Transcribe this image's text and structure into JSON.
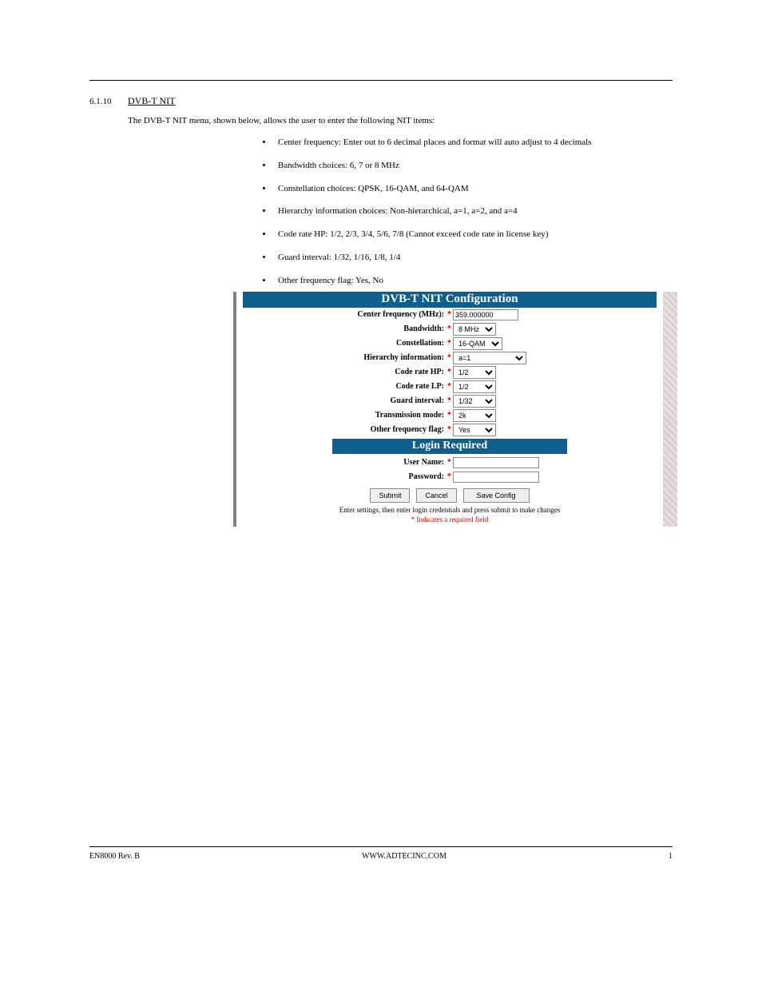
{
  "header": {
    "section_number": "6.1.10",
    "section_title": "DVB-T NIT"
  },
  "intro": "The DVB-T NIT menu, shown below, allows the user to enter the following NIT items:",
  "bullets": [
    "Center frequency: Enter out to 6 decimal places and format will auto adjust to 4 decimals",
    "Bandwidth choices: 6, 7 or 8 MHz",
    "Constellation choices: QPSK, 16-QAM, and 64-QAM",
    "Hierarchy information choices:  Non-hierarchical, a=1, a=2, and a=4",
    "Code rate HP: 1/2, 2/3, 3/4, 5/6, 7/8  (Cannot exceed code rate in license key)",
    "Guard interval: 1/32, 1/16, 1/8, 1/4",
    "Other frequency flag: Yes, No"
  ],
  "panel": {
    "title": "DVB-T NIT Configuration",
    "login_title": "Login Required",
    "fields": {
      "center_freq": {
        "label": "Center frequency (MHz):",
        "value": "359.000000"
      },
      "bandwidth": {
        "label": "Bandwidth:",
        "value": "8 MHz"
      },
      "constellation": {
        "label": "Constellation:",
        "value": "16-QAM"
      },
      "hierarchy": {
        "label": "Hierarchy information:",
        "value": "a=1"
      },
      "code_rate_hp": {
        "label": "Code rate HP:",
        "value": "1/2"
      },
      "code_rate_lp": {
        "label": "Code rate LP:",
        "value": "1/2"
      },
      "guard": {
        "label": "Guard interval:",
        "value": "1/32"
      },
      "tx_mode": {
        "label": "Transmission mode:",
        "value": "2k"
      },
      "other_freq": {
        "label": "Other frequency flag:",
        "value": "Yes"
      }
    },
    "login": {
      "user_label": "User Name:",
      "pass_label": "Password:"
    },
    "buttons": {
      "submit": "Submit",
      "cancel": "Cancel",
      "save": "Save Config"
    },
    "hint1": "Enter settings, then enter login credentials and press submit to make changes",
    "hint2": "* Indicates a required field"
  },
  "footer": {
    "left": "EN8000 Rev. B",
    "center": "WWW.ADTECINC.COM",
    "right": "1"
  }
}
